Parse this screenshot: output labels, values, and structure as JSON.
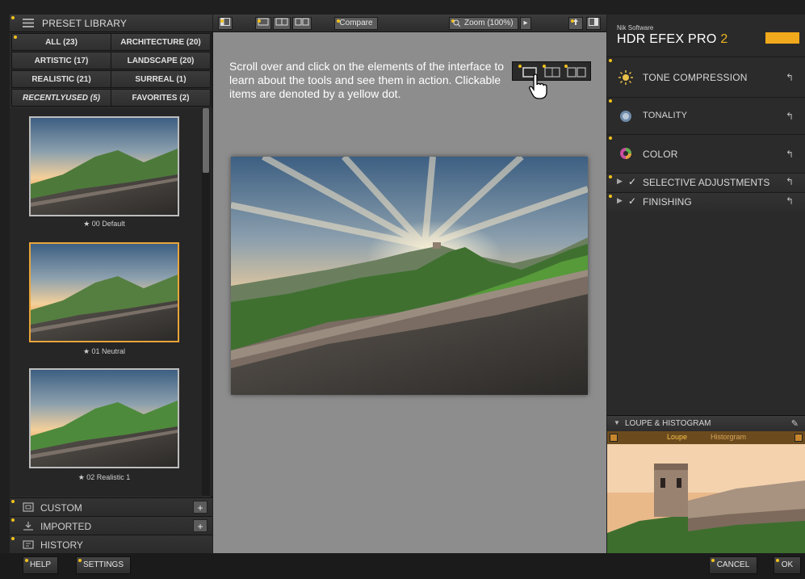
{
  "left_panel": {
    "header_title": "PRESET LIBRARY",
    "categories": [
      {
        "label": "ALL (23)"
      },
      {
        "label": "ARCHITECTURE (20)"
      },
      {
        "label": "ARTISTIC (17)"
      },
      {
        "label": "LANDSCAPE (20)"
      },
      {
        "label": "REALISTIC (21)"
      },
      {
        "label": "SURREAL (1)"
      },
      {
        "label": "RECENTLYUSED (5)"
      },
      {
        "label": "FAVORITES (2)"
      }
    ],
    "thumbnails": [
      {
        "caption": "★ 00 Default"
      },
      {
        "caption": "★ 01 Neutral"
      },
      {
        "caption": "★ 02 Realistic 1"
      }
    ],
    "sections": [
      {
        "label": "CUSTOM",
        "plus": "+"
      },
      {
        "label": "IMPORTED",
        "plus": "+"
      },
      {
        "label": "HISTORY"
      }
    ]
  },
  "toolbar": {
    "compare_label": "Compare",
    "zoom_label": "Zoom (100%)"
  },
  "center": {
    "intro_text": "Scroll over and click on the elements of the interface to learn about the tools and see them in action. Clickable items are denoted by a yellow dot."
  },
  "right_panel": {
    "brand_small": "Nik Software",
    "brand_big": "HDR EFEX PRO",
    "brand_version": "2",
    "adjustments": [
      {
        "label": "TONE COMPRESSION",
        "reset": "↰"
      },
      {
        "label": "TONALITY",
        "reset": "↰"
      },
      {
        "label": "COLOR",
        "reset": "↰"
      }
    ],
    "sub_sections": [
      {
        "label": "SELECTIVE ADJUSTMENTS",
        "check": "✓",
        "reset": "↰"
      },
      {
        "label": "FINISHING",
        "check": "✓",
        "reset": "↰"
      }
    ],
    "loupe": {
      "header": "LOUPE & HISTOGRAM",
      "tab_loupe": "Loupe",
      "tab_histogram": "Historgram"
    }
  },
  "bottom_bar": {
    "help": "HELP",
    "settings": "SETTINGS",
    "cancel": "CANCEL",
    "ok": "OK"
  },
  "colors": {
    "accent_yellow": "#f2c21a",
    "selected_border": "#e8a53a",
    "canvas_gray": "#8d8d8d"
  }
}
